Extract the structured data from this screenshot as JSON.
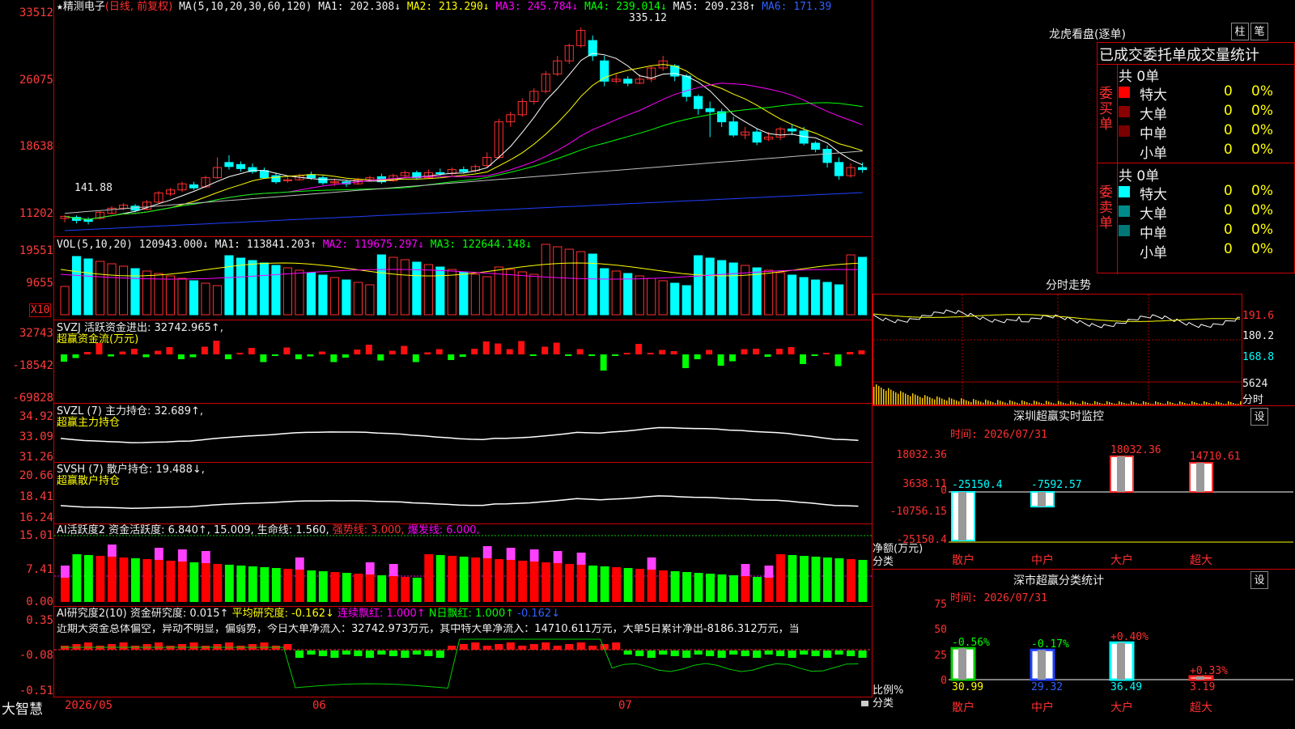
{
  "stock": {
    "name": "精测电子",
    "mode": "(日线, 前复权)"
  },
  "main": {
    "axis": [
      "33512",
      "26075",
      "18638",
      "11202"
    ],
    "ma_label": "MA(5,10,20,30,60,120)",
    "ma1": "MA1: 202.308↓",
    "ma2": "MA2: 213.290↓",
    "ma3": "MA3: 245.784↓",
    "ma4": "MA4: 239.014↓",
    "ma5": "MA5: 209.238↑",
    "ma6": "MA6: 171.39",
    "high_label": "335.12",
    "low_label": "141.88"
  },
  "vol": {
    "axis": [
      "19551",
      "9655"
    ],
    "unit": "X10",
    "label": "VOL(5,10,20)",
    "v": "120943.000↓",
    "ma1": "MA1: 113841.203↑",
    "ma2": "MA2: 119675.297↓",
    "ma3": "MA3: 122644.148↓"
  },
  "svzj": {
    "axis": [
      "32743",
      "-18542",
      "-69828"
    ],
    "label": "SVZJ  活跃资金进出: 32742.965↑,",
    "sub": "超赢资金流(万元)"
  },
  "svzl": {
    "axis": [
      "34.92",
      "33.09",
      "31.26"
    ],
    "label": "SVZL (7) 主力持仓: 32.689↑,",
    "sub": "超赢主力持仓"
  },
  "svsh": {
    "axis": [
      "20.66",
      "18.41",
      "16.24"
    ],
    "label": "SVSH (7) 散户持仓: 19.488↓,",
    "sub": "超赢散户持仓"
  },
  "ai1": {
    "axis": [
      "15.01",
      "7.41",
      "0.00"
    ],
    "label": "AI活跃度2 资金活跃度: 6.840↑, 15.009, 生命线: 1.560,",
    "strong": "强势线: 3.000,",
    "burst": "爆发线: 6.000,"
  },
  "ai2": {
    "axis": [
      "0.35",
      "-0.08",
      "-0.51"
    ],
    "label": "AI研究度2(10) 资金研究度: 0.015↑",
    "avg": "平均研究度: -0.162↓",
    "cont": "连续飘红: 1.000↑",
    "nday": "N日飘红: 1.000↑",
    "last": "-0.162↓",
    "desc": "近期大资金总体偏空，异动不明显，偏弱势，今日大单净流入：32742.973万元，其中特大单净流入：14710.611万元，大单5日累计净出-8186.312万元，当"
  },
  "bottom": {
    "brand": "大智慧",
    "d1": "2026/05",
    "d2": "06",
    "d3": "07"
  },
  "lhb": {
    "title": "龙虎看盘(逐单)",
    "btn1": "柱",
    "btn2": "笔",
    "header": "已成交委托单成交量统计",
    "buy_label": "委买单",
    "sell_label": "委卖单",
    "buy_total": "共 0单",
    "sell_total": "共 0单",
    "rows": [
      {
        "name": "特大",
        "v": "0",
        "p": "0%"
      },
      {
        "name": "大单",
        "v": "0",
        "p": "0%"
      },
      {
        "name": "中单",
        "v": "0",
        "p": "0%"
      },
      {
        "name": "小单",
        "v": "0",
        "p": "0%"
      }
    ],
    "buy_colors": [
      "#ff0000",
      "#8b0000",
      "#7a0000",
      "#000000"
    ],
    "sell_colors": [
      "#00ffff",
      "#008b8b",
      "#007777",
      "#000000"
    ]
  },
  "intraday": {
    "title": "分时走势",
    "axis": [
      "191.6",
      "180.2",
      "168.8",
      "5624"
    ],
    "unit": "分时"
  },
  "sz_monitor": {
    "title": "深圳超赢实时监控",
    "btn": "设",
    "time": "时间: 2026/07/31",
    "axis": [
      "18032.36",
      "3638.11",
      "0",
      "-10756.15",
      "-25150.4"
    ],
    "ylabel1": "净额(万元)",
    "ylabel2": "分类",
    "bars": [
      {
        "cat": "散户",
        "value": -25150.4,
        "label": "-25150.4"
      },
      {
        "cat": "中户",
        "value": -7592.57,
        "label": "-7592.57"
      },
      {
        "cat": "大户",
        "value": 18032.36,
        "label": "18032.36"
      },
      {
        "cat": "超大",
        "value": 14710.61,
        "label": "14710.61"
      }
    ]
  },
  "sz_class": {
    "title": "深市超赢分类统计",
    "btn": "设",
    "time": "时间: 2026/07/31",
    "axis": [
      "75",
      "50",
      "25",
      "0"
    ],
    "ylabel1": "比例%",
    "ylabel2": "分类",
    "bars": [
      {
        "cat": "散户",
        "pct": 30.99,
        "value": "30.99",
        "delta": "-0.56%",
        "color": "#00cc00"
      },
      {
        "cat": "中户",
        "pct": 29.32,
        "value": "29.32",
        "delta": "-0.17%",
        "color": "#2040ff"
      },
      {
        "cat": "大户",
        "pct": 36.49,
        "value": "36.49",
        "delta": "+0.40%",
        "color": "#00ffff"
      },
      {
        "cat": "超大",
        "pct": 3.19,
        "value": "3.19",
        "delta": "+0.33%",
        "color": "#ff2020"
      }
    ]
  },
  "chart_data": {
    "type": "candlestick",
    "candles": [
      [
        150,
        152,
        146,
        153
      ],
      [
        151,
        148,
        145,
        153
      ],
      [
        149,
        147,
        144,
        151
      ],
      [
        150,
        156,
        149,
        157
      ],
      [
        155,
        160,
        154,
        162
      ],
      [
        160,
        163,
        158,
        165
      ],
      [
        162,
        158,
        156,
        164
      ],
      [
        159,
        166,
        158,
        168
      ],
      [
        166,
        175,
        165,
        177
      ],
      [
        174,
        178,
        172,
        180
      ],
      [
        178,
        184,
        176,
        186
      ],
      [
        183,
        180,
        178,
        186
      ],
      [
        181,
        190,
        180,
        192
      ],
      [
        190,
        200,
        189,
        210
      ],
      [
        205,
        201,
        198,
        212
      ],
      [
        203,
        199,
        196,
        206
      ],
      [
        200,
        196,
        194,
        204
      ],
      [
        197,
        190,
        189,
        200
      ],
      [
        192,
        186,
        184,
        195
      ],
      [
        187,
        188,
        185,
        191
      ],
      [
        188,
        192,
        187,
        194
      ],
      [
        193,
        190,
        188,
        196
      ],
      [
        190,
        185,
        183,
        192
      ],
      [
        185,
        186,
        182,
        189
      ],
      [
        186,
        184,
        181,
        188
      ],
      [
        184,
        188,
        183,
        190
      ],
      [
        188,
        190,
        186,
        192
      ],
      [
        191,
        186,
        184,
        194
      ],
      [
        187,
        192,
        186,
        194
      ],
      [
        192,
        195,
        190,
        197
      ],
      [
        195,
        190,
        188,
        197
      ],
      [
        190,
        195,
        189,
        198
      ],
      [
        195,
        194,
        192,
        199
      ],
      [
        194,
        198,
        192,
        200
      ],
      [
        198,
        196,
        194,
        201
      ],
      [
        197,
        201,
        195,
        203
      ],
      [
        202,
        210,
        200,
        215
      ],
      [
        210,
        245,
        208,
        248
      ],
      [
        245,
        252,
        240,
        255
      ],
      [
        252,
        265,
        250,
        268
      ],
      [
        265,
        275,
        262,
        278
      ],
      [
        275,
        292,
        273,
        295
      ],
      [
        292,
        305,
        290,
        310
      ],
      [
        305,
        320,
        302,
        322
      ],
      [
        320,
        335,
        318,
        338
      ],
      [
        325,
        310,
        305,
        330
      ],
      [
        305,
        285,
        280,
        310
      ],
      [
        285,
        287,
        283,
        292
      ],
      [
        287,
        283,
        280,
        290
      ],
      [
        283,
        287,
        282,
        292
      ],
      [
        287,
        298,
        284,
        300
      ],
      [
        298,
        305,
        295,
        310
      ],
      [
        300,
        290,
        285,
        302
      ],
      [
        290,
        270,
        265,
        292
      ],
      [
        270,
        258,
        252,
        272
      ],
      [
        258,
        255,
        230,
        265
      ],
      [
        255,
        245,
        240,
        258
      ],
      [
        245,
        232,
        230,
        250
      ],
      [
        232,
        235,
        228,
        240
      ],
      [
        235,
        225,
        222,
        238
      ],
      [
        228,
        230,
        226,
        235
      ],
      [
        230,
        238,
        227,
        240
      ],
      [
        238,
        236,
        232,
        242
      ],
      [
        236,
        224,
        222,
        240
      ],
      [
        224,
        218,
        215,
        226
      ],
      [
        218,
        205,
        200,
        222
      ],
      [
        205,
        192,
        188,
        210
      ],
      [
        192,
        200,
        190,
        204
      ],
      [
        200,
        198,
        195,
        205
      ]
    ]
  }
}
